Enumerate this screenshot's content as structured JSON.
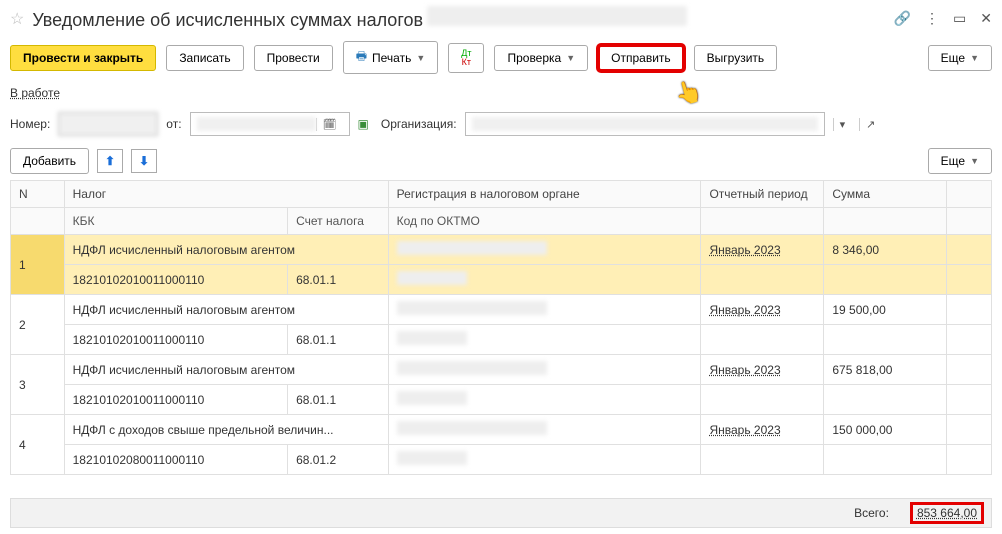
{
  "header": {
    "title": "Уведомление об исчисленных суммах налогов"
  },
  "toolbar": {
    "post_close": "Провести и закрыть",
    "save": "Записать",
    "post": "Провести",
    "print": "Печать",
    "check": "Проверка",
    "send": "Отправить",
    "export": "Выгрузить",
    "more": "Еще"
  },
  "status": {
    "label": "В работе"
  },
  "fields": {
    "number_label": "Номер:",
    "from_label": "от:",
    "org_label": "Организация:"
  },
  "row2": {
    "add": "Добавить",
    "more": "Еще"
  },
  "table": {
    "headers": {
      "n": "N",
      "tax": "Налог",
      "reg": "Регистрация в налоговом органе",
      "period": "Отчетный период",
      "sum": "Сумма",
      "kbk": "КБК",
      "acc": "Счет налога",
      "oktmo": "Код по ОКТМО"
    },
    "rows": [
      {
        "n": "1",
        "tax": "НДФЛ исчисленный налоговым агентом",
        "kbk": "18210102010011000110",
        "acc": "68.01.1",
        "period": "Январь 2023",
        "sum": "8 346,00"
      },
      {
        "n": "2",
        "tax": "НДФЛ исчисленный налоговым агентом",
        "kbk": "18210102010011000110",
        "acc": "68.01.1",
        "period": "Январь 2023",
        "sum": "19 500,00"
      },
      {
        "n": "3",
        "tax": "НДФЛ исчисленный налоговым агентом",
        "kbk": "18210102010011000110",
        "acc": "68.01.1",
        "period": "Январь 2023",
        "sum": "675 818,00"
      },
      {
        "n": "4",
        "tax": "НДФЛ с доходов свыше предельной величин...",
        "kbk": "18210102080011000110",
        "acc": "68.01.2",
        "period": "Январь 2023",
        "sum": "150 000,00"
      }
    ]
  },
  "footer": {
    "total_label": "Всего:",
    "total_value": "853 664,00"
  }
}
